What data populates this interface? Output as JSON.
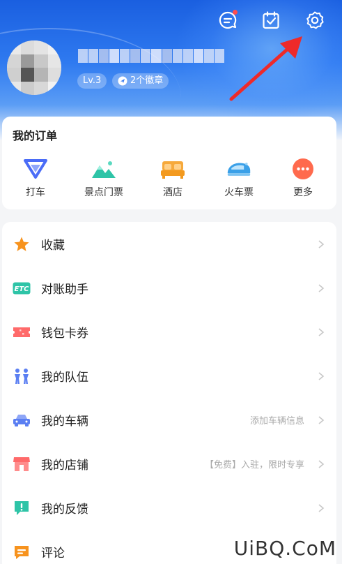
{
  "header": {
    "level_badge": "Lv.3",
    "medal_badge": "2个徽章"
  },
  "orders": {
    "title": "我的订单",
    "items": [
      {
        "label": "打车",
        "icon": "taxi-icon",
        "color": "#4a6cf7"
      },
      {
        "label": "景点门票",
        "icon": "mountain-icon",
        "color": "#2ec4a7"
      },
      {
        "label": "酒店",
        "icon": "bed-icon",
        "color": "#f6a93b"
      },
      {
        "label": "火车票",
        "icon": "train-icon",
        "color": "#3aa0e8"
      },
      {
        "label": "更多",
        "icon": "more-icon",
        "color": "#ff6a4d"
      }
    ]
  },
  "menu": [
    {
      "label": "收藏",
      "icon": "star-icon",
      "color": "#f7931e",
      "hint": ""
    },
    {
      "label": "对账助手",
      "icon": "etc-icon",
      "color": "#2ec4a7",
      "hint": ""
    },
    {
      "label": "钱包卡券",
      "icon": "ticket-icon",
      "color": "#ff6a6a",
      "hint": ""
    },
    {
      "label": "我的队伍",
      "icon": "team-icon",
      "color": "#5b7ff2",
      "hint": ""
    },
    {
      "label": "我的车辆",
      "icon": "car-icon",
      "color": "#5b7ff2",
      "hint": "添加车辆信息"
    },
    {
      "label": "我的店铺",
      "icon": "shop-icon",
      "color": "#ff6a6a",
      "hint": "【免费】入驻，限时专享"
    },
    {
      "label": "我的反馈",
      "icon": "feedback-icon",
      "color": "#2ec4a7",
      "hint": ""
    },
    {
      "label": "评论",
      "icon": "comment-icon",
      "color": "#f7931e",
      "hint": ""
    }
  ],
  "watermark": "UiBQ.CoM"
}
